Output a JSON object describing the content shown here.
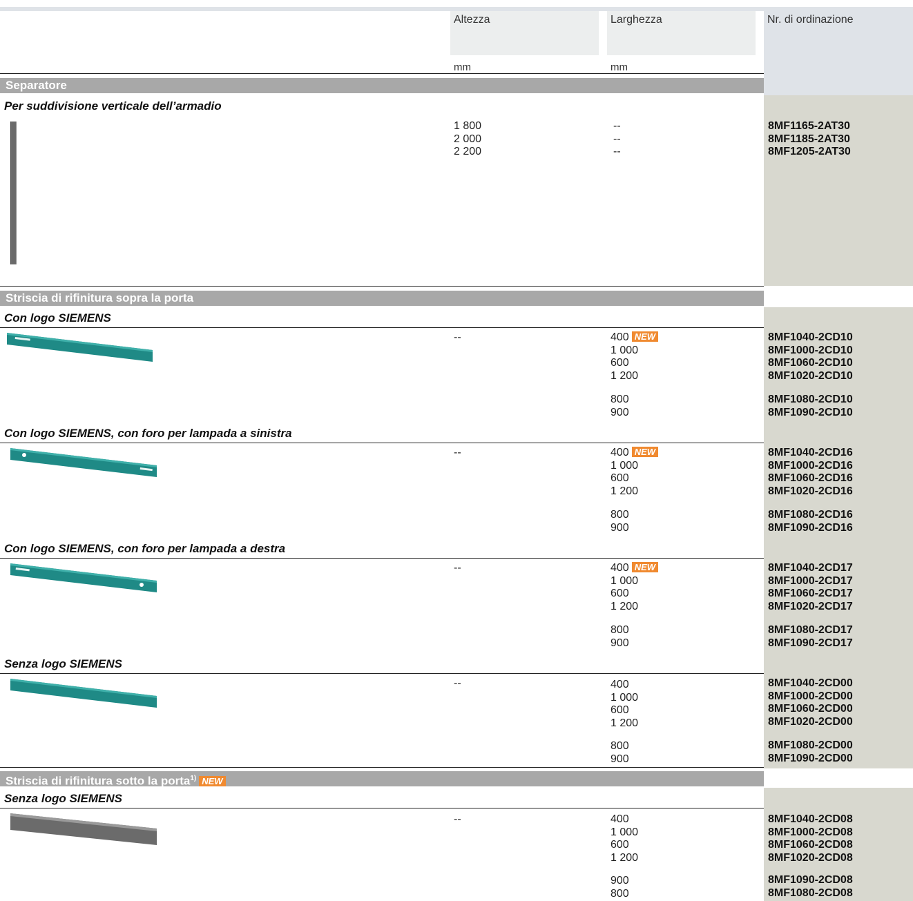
{
  "header": {
    "col_height": "Altezza",
    "col_width": "Larghezza",
    "col_order": "Nr. di ordinazione",
    "unit_height": "mm",
    "unit_width": "mm"
  },
  "new_badge": "NEW",
  "colors": {
    "teal": "#1f8a86",
    "section_gray": "#a8a8a8",
    "order_bg": "#d8d8cf",
    "new_orange": "#f08a30"
  },
  "sections": {
    "separatore": {
      "title": "Separatore",
      "sub": "Per suddivisione verticale dell’armadio",
      "height": [
        "1 800",
        "2 000",
        "2 200"
      ],
      "width": [
        "--",
        "--",
        "--"
      ],
      "codes": [
        "8MF1165-2AT30",
        "8MF1185-2AT30",
        "8MF1205-2AT30"
      ]
    },
    "sopra": {
      "title": "Striscia di rifinitura sopra la porta",
      "groups": [
        {
          "sub": "Con logo SIEMENS",
          "height": "--",
          "widths_a": [
            "400",
            "1 000",
            "600",
            "1 200"
          ],
          "widths_b": [
            "800",
            "900"
          ],
          "codes_a": [
            "8MF1040-2CD10",
            "8MF1000-2CD10",
            "8MF1060-2CD10",
            "8MF1020-2CD10"
          ],
          "codes_b": [
            "8MF1080-2CD10",
            "8MF1090-2CD10"
          ]
        },
        {
          "sub": "Con logo SIEMENS, con foro per lampada a sinistra",
          "height": "--",
          "widths_a": [
            "400",
            "1 000",
            "600",
            "1 200"
          ],
          "widths_b": [
            "800",
            "900"
          ],
          "codes_a": [
            "8MF1040-2CD16",
            "8MF1000-2CD16",
            "8MF1060-2CD16",
            "8MF1020-2CD16"
          ],
          "codes_b": [
            "8MF1080-2CD16",
            "8MF1090-2CD16"
          ]
        },
        {
          "sub": "Con logo SIEMENS, con foro per lampada a destra",
          "height": "--",
          "widths_a": [
            "400",
            "1 000",
            "600",
            "1 200"
          ],
          "widths_b": [
            "800",
            "900"
          ],
          "codes_a": [
            "8MF1040-2CD17",
            "8MF1000-2CD17",
            "8MF1060-2CD17",
            "8MF1020-2CD17"
          ],
          "codes_b": [
            "8MF1080-2CD17",
            "8MF1090-2CD17"
          ]
        },
        {
          "sub": "Senza logo SIEMENS",
          "height": "--",
          "widths_a": [
            "400",
            "1 000",
            "600",
            "1 200"
          ],
          "widths_b": [
            "800",
            "900"
          ],
          "codes_a": [
            "8MF1040-2CD00",
            "8MF1000-2CD00",
            "8MF1060-2CD00",
            "8MF1020-2CD00"
          ],
          "codes_b": [
            "8MF1080-2CD00",
            "8MF1090-2CD00"
          ]
        }
      ]
    },
    "sotto": {
      "title": "Striscia di rifinitura sotto la porta",
      "title_sup": "1)",
      "sub": "Senza logo SIEMENS",
      "height": "--",
      "widths_a": [
        "400",
        "1 000",
        "600",
        "1 200"
      ],
      "widths_b": [
        "900",
        "800"
      ],
      "codes_a": [
        "8MF1040-2CD08",
        "8MF1000-2CD08",
        "8MF1060-2CD08",
        "8MF1020-2CD08"
      ],
      "codes_b": [
        "8MF1090-2CD08",
        "8MF1080-2CD08"
      ]
    }
  }
}
